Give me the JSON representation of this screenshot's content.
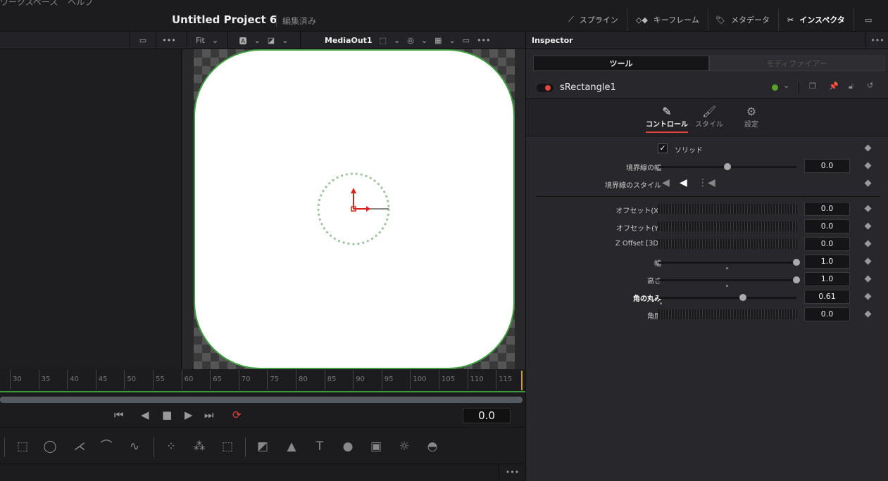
{
  "menubar": [
    "ワークスペース",
    "ヘルプ"
  ],
  "header": {
    "title": "Untitled Project 6",
    "status": "編集済み",
    "buttons": [
      {
        "label": "スプライン",
        "icon": "spline-icon"
      },
      {
        "label": "キーフレーム",
        "icon": "keyframe-icon"
      },
      {
        "label": "メタデータ",
        "icon": "metadata-icon"
      },
      {
        "label": "インスペクタ",
        "icon": "inspector-icon",
        "active": true
      }
    ]
  },
  "viewer": {
    "zoom": "Fit",
    "output": "MediaOut1"
  },
  "timeline": {
    "ticks": [
      "30",
      "35",
      "40",
      "45",
      "50",
      "55",
      "60",
      "65",
      "70",
      "75",
      "80",
      "85",
      "90",
      "95",
      "100",
      "105",
      "110",
      "115"
    ],
    "timecode": "0.0"
  },
  "inspector": {
    "title": "Inspector",
    "tabs": [
      "ツール",
      "モディファイアー"
    ],
    "node": "sRectangle1",
    "subtabs": [
      "コントロール",
      "スタイル",
      "設定"
    ],
    "solid_label": "ソリッド",
    "solid_checked": true,
    "border_width": {
      "label": "境界線の幅",
      "value": "0.0",
      "fraction": 0.5
    },
    "border_style_label": "境界線のスタイル",
    "params": [
      {
        "label": "オフセット(X)",
        "value": "0.0",
        "type": "dial"
      },
      {
        "label": "オフセット(Y)",
        "value": "0.0",
        "type": "dial"
      },
      {
        "label": "Z Offset [3D]",
        "value": "0.0",
        "type": "dial"
      },
      {
        "label": "幅",
        "value": "1.0",
        "type": "slider",
        "fraction": 1.0
      },
      {
        "label": "高さ",
        "value": "1.0",
        "type": "slider",
        "fraction": 1.0
      },
      {
        "label": "角の丸み",
        "value": "0.61",
        "type": "slider",
        "fraction": 0.61
      },
      {
        "label": "角度",
        "value": "0.0",
        "type": "dial"
      }
    ]
  },
  "colors": {
    "accent_red": "#e0443a",
    "node_green": "#5aa02c",
    "border_green": "#3fa03f"
  }
}
